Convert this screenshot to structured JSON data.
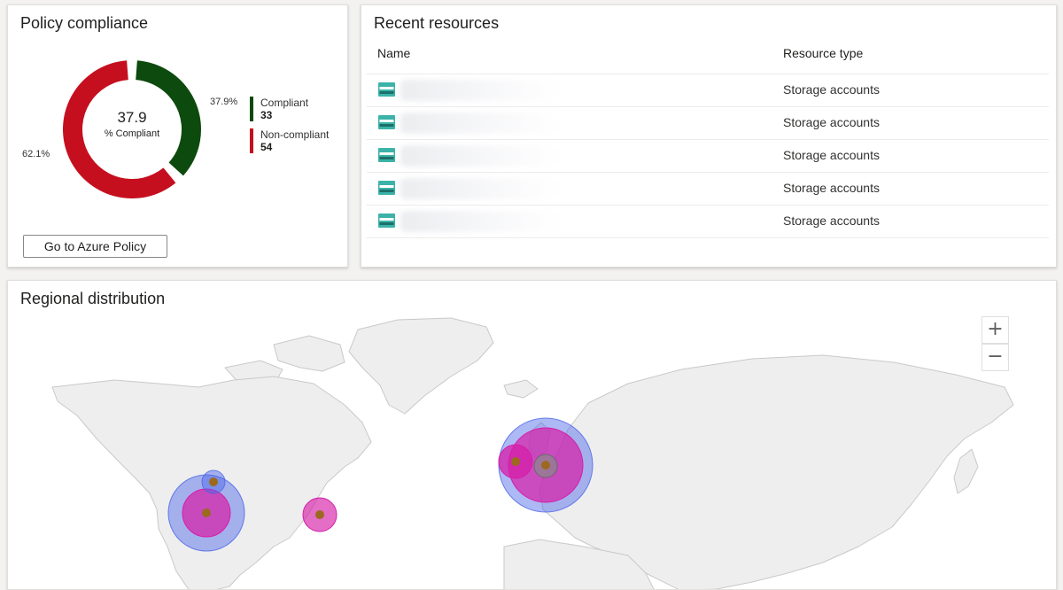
{
  "policy": {
    "title": "Policy compliance",
    "center_value": "37.9",
    "center_label": "% Compliant",
    "compliant_pct_label": "37.9%",
    "noncompliant_pct_label": "62.1%",
    "compliant_fraction": 0.379,
    "legend": [
      {
        "label": "Compliant",
        "value": "33",
        "color": "#0d4a0d"
      },
      {
        "label": "Non-compliant",
        "value": "54",
        "color": "#c50f1f"
      }
    ],
    "button_label": "Go to Azure Policy"
  },
  "resources": {
    "title": "Recent resources",
    "columns": [
      "Name",
      "Resource type"
    ],
    "rows": [
      {
        "type": "Storage accounts",
        "icon": "storage-account-icon"
      },
      {
        "type": "Storage accounts",
        "icon": "storage-account-icon"
      },
      {
        "type": "Storage accounts",
        "icon": "storage-account-icon"
      },
      {
        "type": "Storage accounts",
        "icon": "storage-account-icon"
      },
      {
        "type": "Storage accounts",
        "icon": "storage-account-icon"
      }
    ]
  },
  "regional": {
    "title": "Regional distribution",
    "zoom_in_label": "+",
    "zoom_out_label": "−",
    "bubble_colors": {
      "blue": "#4a63e8",
      "magenta": "#d61ea8",
      "marker": "#9b6a1e"
    }
  }
}
